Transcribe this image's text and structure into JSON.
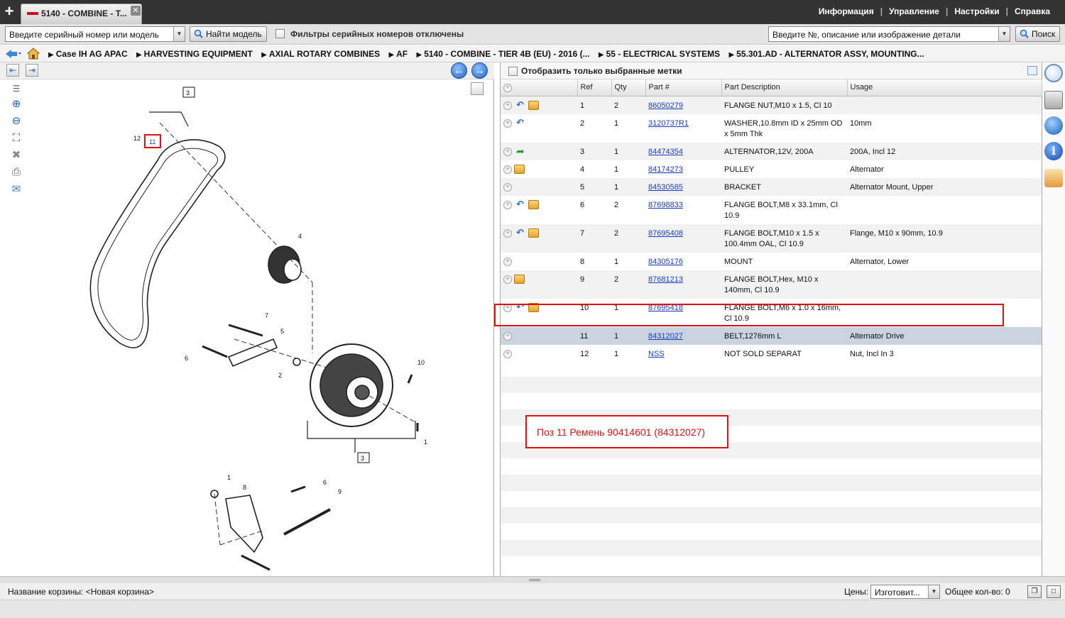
{
  "tab": {
    "label": "5140 - COMBINE - T..."
  },
  "top_menu": [
    "Информация",
    "Управление",
    "Настройки",
    "Справка"
  ],
  "toolbar": {
    "serial_input": "Введите серийный номер или модель",
    "find_model_label": "Найти модель",
    "filter_label": "Фильтры серийных номеров отключены",
    "part_search_input": "Введите №, описание или изображение детали",
    "search_label": "Поиск"
  },
  "breadcrumb": [
    "Case IH AG APAC",
    "HARVESTING EQUIPMENT",
    "AXIAL ROTARY COMBINES",
    "AF",
    "5140 - COMBINE - TIER 4B (EU) - 2016 (...",
    "55 - ELECTRICAL SYSTEMS",
    "55.301.AD - ALTERNATOR ASSY, MOUNTING..."
  ],
  "parts_panel": {
    "show_selected_label": "Отобразить только выбранные метки",
    "columns": [
      "Ref",
      "Qty",
      "Part #",
      "Part Description",
      "Usage"
    ],
    "rows": [
      {
        "icons": [
          "arrow",
          "package"
        ],
        "ref": "1",
        "qty": "2",
        "part": "86050279",
        "desc": "FLANGE NUT,M10 x 1.5, Cl 10",
        "usage": ""
      },
      {
        "icons": [
          "arrow"
        ],
        "ref": "2",
        "qty": "1",
        "part": "3120737R1",
        "desc": "WASHER,10.8mm ID x 25mm OD x 5mm Thk",
        "usage": "10mm"
      },
      {
        "icons": [
          "green-arrow"
        ],
        "ref": "3",
        "qty": "1",
        "part": "84474354",
        "desc": "ALTERNATOR,12V, 200A",
        "usage": "200A, Incl 12"
      },
      {
        "icons": [
          "package"
        ],
        "ref": "4",
        "qty": "1",
        "part": "84174273",
        "desc": "PULLEY",
        "usage": "Alternator"
      },
      {
        "icons": [],
        "ref": "5",
        "qty": "1",
        "part": "84530585",
        "desc": "BRACKET",
        "usage": "Alternator Mount, Upper"
      },
      {
        "icons": [
          "arrow",
          "package"
        ],
        "ref": "6",
        "qty": "2",
        "part": "87698833",
        "desc": "FLANGE BOLT,M8 x 33.1mm, Cl 10.9",
        "usage": ""
      },
      {
        "icons": [
          "arrow",
          "package"
        ],
        "ref": "7",
        "qty": "2",
        "part": "87695408",
        "desc": "FLANGE BOLT,M10 x 1.5 x 100.4mm OAL, Cl 10.9",
        "usage": "Flange, M10 x 90mm, 10.9"
      },
      {
        "icons": [],
        "ref": "8",
        "qty": "1",
        "part": "84305176",
        "desc": "MOUNT",
        "usage": "Alternator, Lower"
      },
      {
        "icons": [
          "package"
        ],
        "ref": "9",
        "qty": "2",
        "part": "87681213",
        "desc": "FLANGE BOLT,Hex, M10 x 140mm, Cl 10.9",
        "usage": ""
      },
      {
        "icons": [
          "arrow",
          "package"
        ],
        "ref": "10",
        "qty": "1",
        "part": "87695418",
        "desc": "FLANGE BOLT,M6 x 1.0 x 16mm, Cl 10.9",
        "usage": ""
      },
      {
        "icons": [],
        "ref": "11",
        "qty": "1",
        "part": "84312027",
        "desc": "BELT,1276mm L",
        "usage": "Alternator Drive",
        "selected": true
      },
      {
        "icons": [],
        "ref": "12",
        "qty": "1",
        "part": "NSS",
        "desc": "NOT SOLD SEPARAT",
        "usage": "Nut, Incl In 3"
      }
    ]
  },
  "annotation": {
    "note": "Поз 11 Ремень 90414601 (84312027)"
  },
  "diagram_labels": [
    "3",
    "12",
    "11",
    "4",
    "7",
    "5",
    "6",
    "2",
    "10",
    "1",
    "3",
    "1",
    "8",
    "6",
    "9",
    "7"
  ],
  "bottom": {
    "cart_label": "Название корзины:  <Новая корзина>",
    "prices_label": "Цены:",
    "prices_select": "Изготовит...",
    "total_label": "Общее кол-во: 0"
  },
  "colors": {
    "accent_red": "#e01010",
    "link_blue": "#1a3cc0",
    "topbar": "#333333",
    "selected_row": "#c9d4e0"
  }
}
